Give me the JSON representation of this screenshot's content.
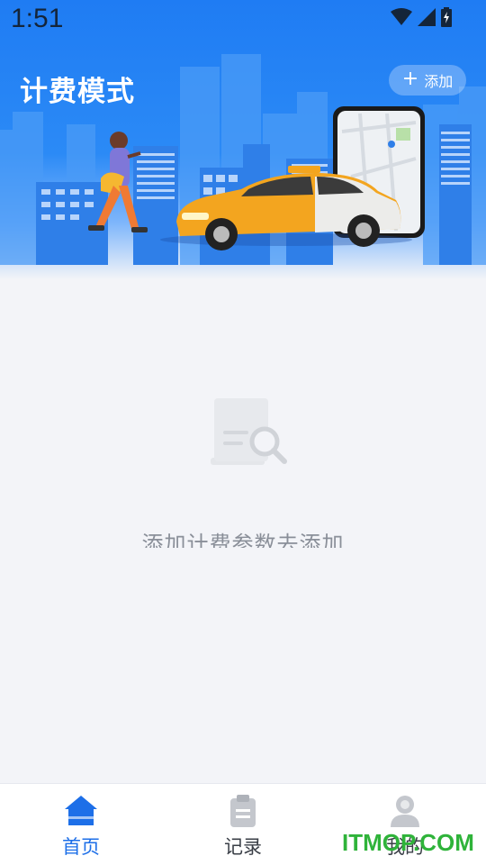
{
  "status_bar": {
    "time": "1:51"
  },
  "header": {
    "title": "计费模式",
    "add_label": "添加"
  },
  "empty_state": {
    "message": "添加计费参数去添加"
  },
  "tabbar": {
    "tabs": [
      {
        "label": "首页"
      },
      {
        "label": "记录"
      },
      {
        "label": "我的"
      }
    ]
  },
  "watermark": {
    "text": "ITMOP.COM"
  },
  "colors": {
    "primary": "#1d6fe8",
    "header_blue": "#1f7cf3",
    "background": "#f3f4f8",
    "watermark": "#2fb33a"
  }
}
